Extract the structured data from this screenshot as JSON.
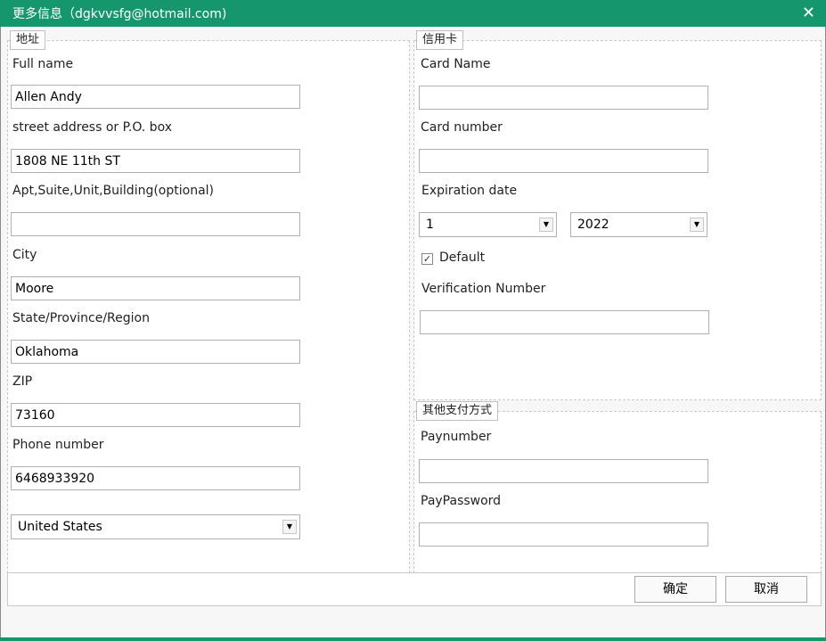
{
  "window": {
    "title": "更多信息（dgkvvsfg@hotmail.com)",
    "close_icon": "close-icon",
    "accent_color": "#15966d"
  },
  "address": {
    "legend": "地址",
    "full_name_label": "Full name",
    "full_name_value": "Allen Andy",
    "street_label": "street address or P.O. box",
    "street_value": "1808 NE 11th ST",
    "apt_label": "Apt,Suite,Unit,Building(optional)",
    "apt_value": "",
    "city_label": "City",
    "city_value": "Moore",
    "state_label": "State/Province/Region",
    "state_value": "Oklahoma",
    "zip_label": "ZIP",
    "zip_value": "73160",
    "phone_label": "Phone number",
    "phone_value": "6468933920",
    "country_value": "United States"
  },
  "credit_card": {
    "legend": "信用卡",
    "card_name_label": "Card Name",
    "card_name_value": "",
    "card_number_label": "Card number",
    "card_number_value": "",
    "expiration_label": "Expiration date",
    "exp_month_value": "1",
    "exp_year_value": "2022",
    "default_label": "Default",
    "default_checked": true,
    "verification_label": "Verification Number",
    "verification_value": ""
  },
  "other_payment": {
    "legend": "其他支付方式",
    "paynumber_label": "Paynumber",
    "paynumber_value": "",
    "paypassword_label": "PayPassword",
    "paypassword_value": ""
  },
  "footer": {
    "ok_label": "确定",
    "cancel_label": "取消"
  }
}
